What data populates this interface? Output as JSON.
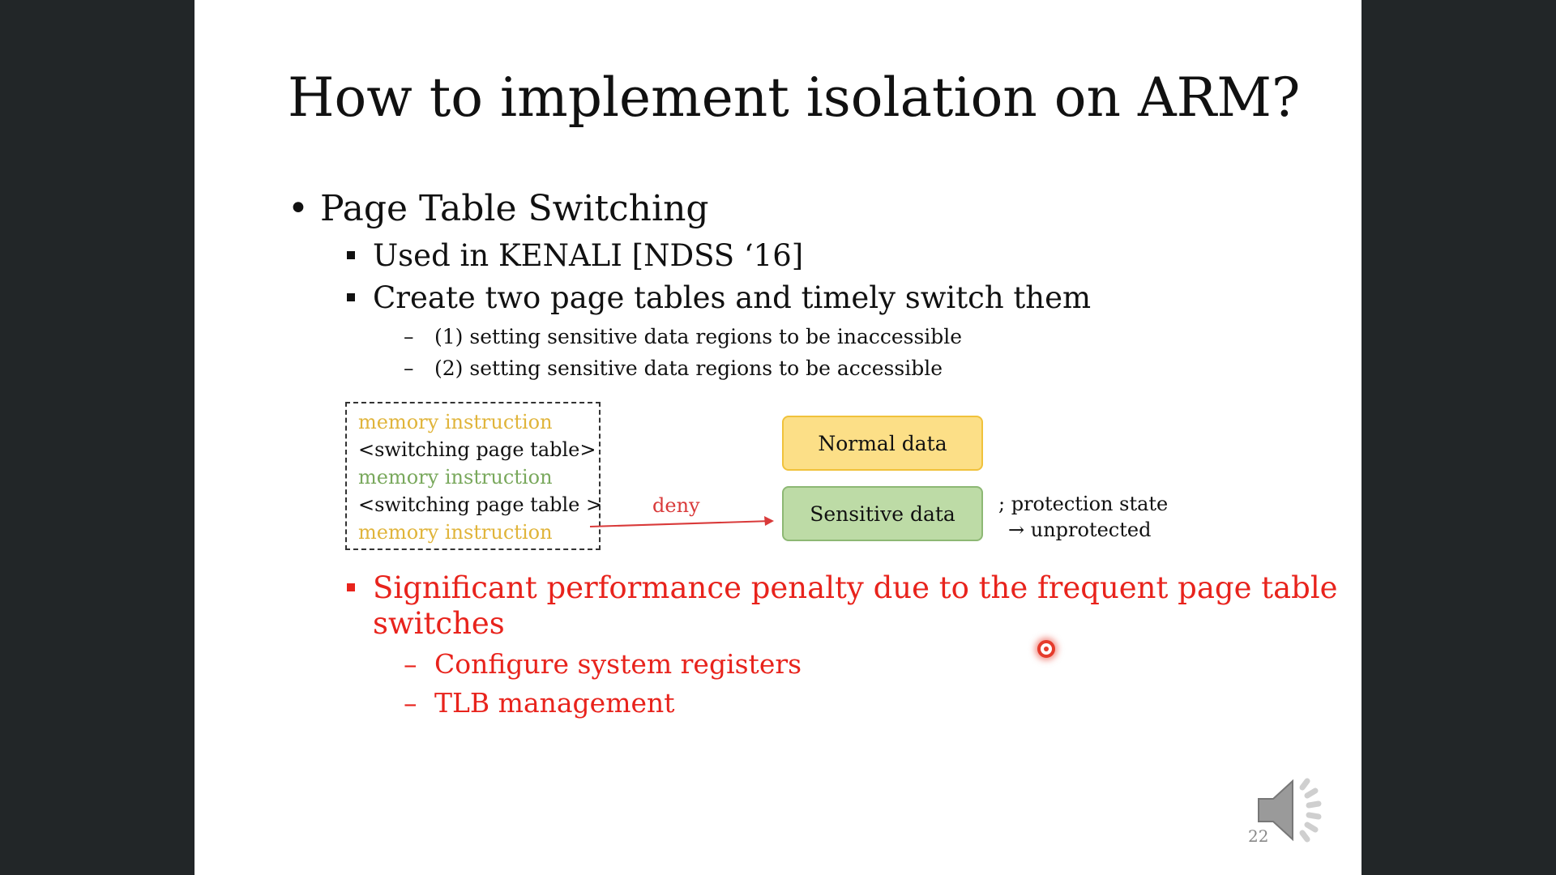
{
  "slide": {
    "title": "How to implement isolation on ARM?",
    "bullet1": {
      "marker": "•",
      "text": "Page Table Switching"
    },
    "sub_bullets": [
      {
        "text": "Used in KENALI [NDSS ‘16]"
      },
      {
        "text": "Create two page tables and timely switch them"
      }
    ],
    "sub_sub_bullets": [
      {
        "marker": "–",
        "text": "(1) setting sensitive data regions to be inaccessible"
      },
      {
        "marker": "–",
        "text": "(2) setting sensitive data regions to be accessible"
      }
    ],
    "diagram": {
      "code_lines": [
        {
          "text": "memory instruction",
          "color": "#E0B43A"
        },
        {
          "text": "<switching page table>",
          "color": "#111111"
        },
        {
          "text": "memory instruction",
          "color": "#79A85C"
        },
        {
          "text": "<switching page table >",
          "color": "#111111"
        },
        {
          "text": "memory instruction",
          "color": "#E0B43A"
        }
      ],
      "deny_label": "deny",
      "normal_box": "Normal data",
      "sensitive_box": "Sensitive data",
      "protection_line1": "; protection state",
      "protection_line2": "→ unprotected"
    },
    "penalty_bullet": {
      "line1": "Significant performance penalty due to the frequent page table",
      "line2": "switches"
    },
    "penalty_sub": [
      {
        "marker": "–",
        "text": "Configure system registers"
      },
      {
        "marker": "–",
        "text": "TLB management"
      }
    ],
    "page_number": "22",
    "colors": {
      "accent_red": "#E8231C",
      "normal_fill": "#FCDF87",
      "sensitive_fill": "#BDDBA6"
    },
    "icons": {
      "speaker": "speaker-icon",
      "pointer": "laser-pointer-icon"
    }
  }
}
